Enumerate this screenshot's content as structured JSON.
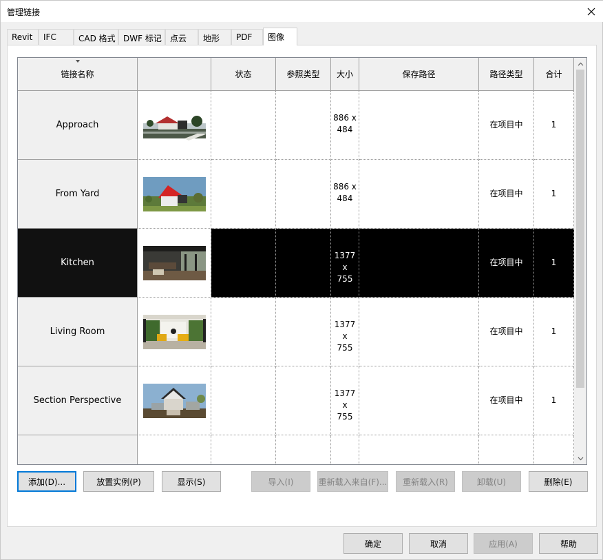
{
  "window": {
    "title": "管理链接"
  },
  "tabs": [
    {
      "label": "Revit"
    },
    {
      "label": "IFC"
    },
    {
      "label": "CAD 格式"
    },
    {
      "label": "DWF 标记"
    },
    {
      "label": "点云"
    },
    {
      "label": "地形"
    },
    {
      "label": "PDF"
    },
    {
      "label": "图像",
      "active": true
    }
  ],
  "table": {
    "columns": [
      "链接名称",
      "",
      "状态",
      "参照类型",
      "大小",
      "保存路径",
      "路径类型",
      "合计"
    ],
    "sorted_column": "链接名称",
    "rows": [
      {
        "name": "Approach",
        "thumbnail": "approach-image-thumbnail",
        "status": "",
        "reference_type": "",
        "size": "886 x\n484",
        "saved_path": "",
        "path_type": "在项目中",
        "count": "1",
        "selected": false
      },
      {
        "name": "From Yard",
        "thumbnail": "from-yard-image-thumbnail",
        "status": "",
        "reference_type": "",
        "size": "886 x\n484",
        "saved_path": "",
        "path_type": "在项目中",
        "count": "1",
        "selected": false
      },
      {
        "name": "Kitchen",
        "thumbnail": "kitchen-image-thumbnail",
        "status": "",
        "reference_type": "",
        "size": "1377 x\n755",
        "saved_path": "",
        "path_type": "在项目中",
        "count": "1",
        "selected": true
      },
      {
        "name": "Living Room",
        "thumbnail": "living-room-image-thumbnail",
        "status": "",
        "reference_type": "",
        "size": "1377 x\n755",
        "saved_path": "",
        "path_type": "在项目中",
        "count": "1",
        "selected": false
      },
      {
        "name": "Section Perspective",
        "thumbnail": "section-perspective-image-thumbnail",
        "status": "",
        "reference_type": "",
        "size": "1377 x\n755",
        "saved_path": "",
        "path_type": "在项目中",
        "count": "1",
        "selected": false
      }
    ]
  },
  "actions": {
    "add": "添加(D)...",
    "place_instance": "放置实例(P)",
    "show": "显示(S)",
    "import": "导入(I)",
    "reload_from": "重新载入来自(F)...",
    "reload": "重新载入(R)",
    "unload": "卸载(U)",
    "delete": "删除(E)"
  },
  "footer": {
    "ok": "确定",
    "cancel": "取消",
    "apply": "应用(A)",
    "help": "帮助"
  },
  "colors": {
    "selection": "#000000",
    "focus_border": "#0078d7",
    "header_bg": "#f0f0f0"
  }
}
